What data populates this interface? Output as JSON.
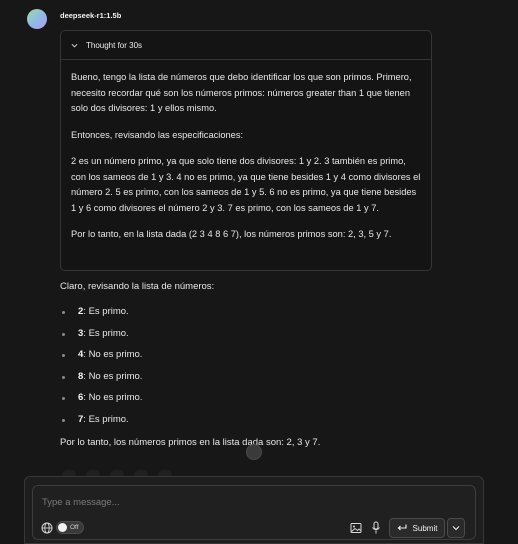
{
  "message": {
    "model_name": "deepseek-r1:1.5b",
    "thought": {
      "title": "Thought for 30s",
      "paragraphs": [
        "Bueno, tengo la lista de números que debo identificar los que son primos. Primero, necesito recordar qué son los números primos: números greater than 1 que tienen solo dos divisores: 1 y ellos mismo.",
        "Entonces, revisando las especificaciones:",
        "2 es un número primo, ya que solo tiene dos divisores: 1 y 2. 3 también es primo, con los sameos de 1 y 3. 4 no es primo, ya que tiene besides 1 y 4 como divisores el número 2. 5 es primo, con los sameos de 1 y 5. 6 no es primo, ya que tiene besides 1 y 6 como divisores el número 2 y 3. 7 es primo, con los sameos de 1 y 7.",
        "Por lo tanto, en la lista dada (2 3 4 8 6 7), los números primos son: 2, 3, 5 y 7."
      ]
    },
    "answer": {
      "intro": "Claro, revisando la lista de números:",
      "items": [
        {
          "number": "2",
          "text": ": Es primo."
        },
        {
          "number": "3",
          "text": ": Es primo."
        },
        {
          "number": "4",
          "text": ": No es primo."
        },
        {
          "number": "8",
          "text": ": No es primo."
        },
        {
          "number": "6",
          "text": ": No es primo."
        },
        {
          "number": "7",
          "text": ": Es primo."
        }
      ],
      "conclusion": "Por lo tanto, los números primos en la lista dada son: 2, 3 y 7."
    }
  },
  "composer": {
    "placeholder": "Type a message...",
    "toggle_label": "Off",
    "submit_label": "Submit",
    "icons": {
      "web": "globe-icon",
      "image": "image-icon",
      "voice": "mic-icon",
      "submit": "enter-icon",
      "dropdown": "chevron-down-icon"
    }
  }
}
